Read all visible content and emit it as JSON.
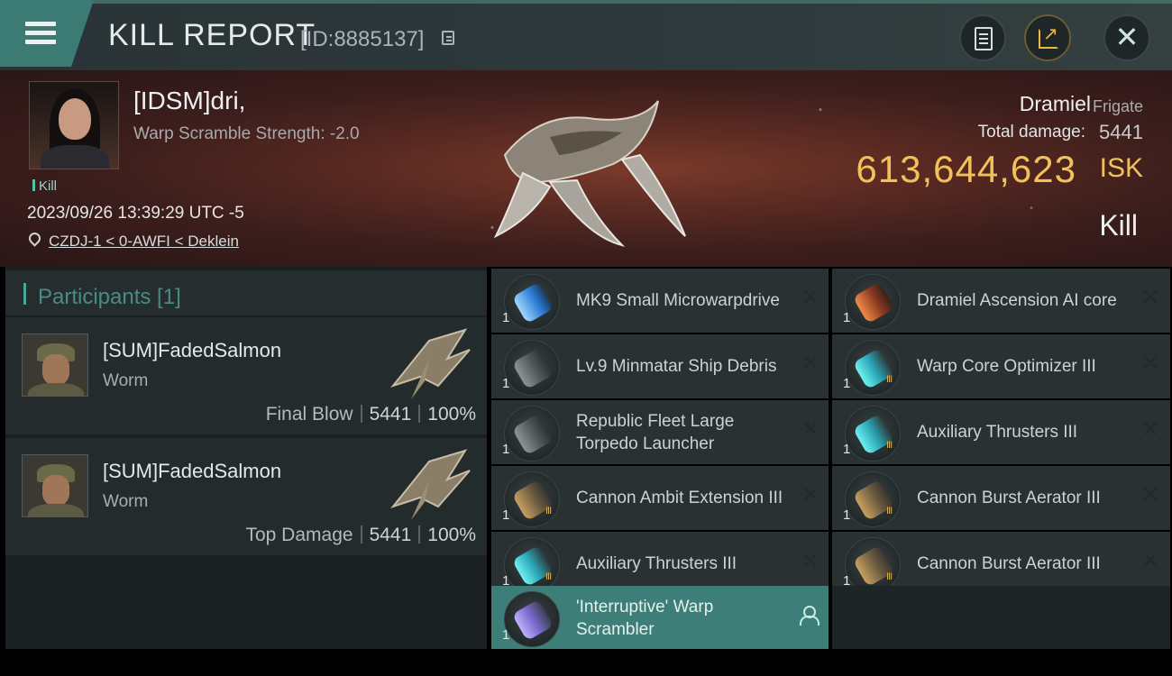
{
  "header": {
    "title": "KILL REPORT",
    "report_id": "[ID:8885137]"
  },
  "victim": {
    "name": "[IDSM]dri,",
    "warp_scramble": "Warp Scramble Strength: -2.0",
    "tag": "Kill",
    "timestamp": "2023/09/26 13:39:29 UTC -5",
    "location": "CZDJ-1 < 0-AWFI < Deklein",
    "ship_name": "Dramiel",
    "ship_class": "Frigate",
    "total_damage_label": "Total damage:",
    "total_damage": "5441",
    "isk_value": "613,644,623",
    "isk_unit": "ISK",
    "result": "Kill"
  },
  "participants": {
    "title": "Participants [1]",
    "rows": [
      {
        "name": "[SUM]FadedSalmon",
        "ship": "Worm",
        "role": "Final Blow",
        "damage": "5441",
        "percent": "100%"
      },
      {
        "name": "[SUM]FadedSalmon",
        "ship": "Worm",
        "role": "Top Damage",
        "damage": "5441",
        "percent": "100%"
      }
    ]
  },
  "modules": {
    "left": [
      {
        "label": "MK9 Small Microwarpdrive",
        "qty": "1",
        "icon": "microwarpdrive-icon"
      },
      {
        "label": "Lv.9 Minmatar Ship Debris",
        "qty": "1",
        "icon": "debris-icon"
      },
      {
        "label": "Republic Fleet Large Torpedo Launcher",
        "qty": "1",
        "icon": "torpedo-launcher-icon"
      },
      {
        "label": "Cannon Ambit Extension III",
        "qty": "1",
        "icon": "cannon-rig-icon"
      },
      {
        "label": "Auxiliary Thrusters III",
        "qty": "1",
        "icon": "thrusters-icon"
      },
      {
        "label": "'Interruptive' Warp Scrambler",
        "qty": "1",
        "icon": "warp-scrambler-icon"
      }
    ],
    "right": [
      {
        "label": "Dramiel Ascension AI core",
        "qty": "1",
        "icon": "ai-core-icon"
      },
      {
        "label": "Warp Core Optimizer III",
        "qty": "1",
        "icon": "warp-core-optimizer-icon"
      },
      {
        "label": "Auxiliary Thrusters III",
        "qty": "1",
        "icon": "thrusters-icon"
      },
      {
        "label": "Cannon Burst Aerator III",
        "qty": "1",
        "icon": "cannon-rig-icon"
      },
      {
        "label": "Cannon Burst Aerator III",
        "qty": "1",
        "icon": "cannon-rig-icon"
      }
    ]
  },
  "colors": {
    "accent_teal": "#3c7a74",
    "isk_gold": "#f2c15a",
    "panel": "#293133"
  }
}
